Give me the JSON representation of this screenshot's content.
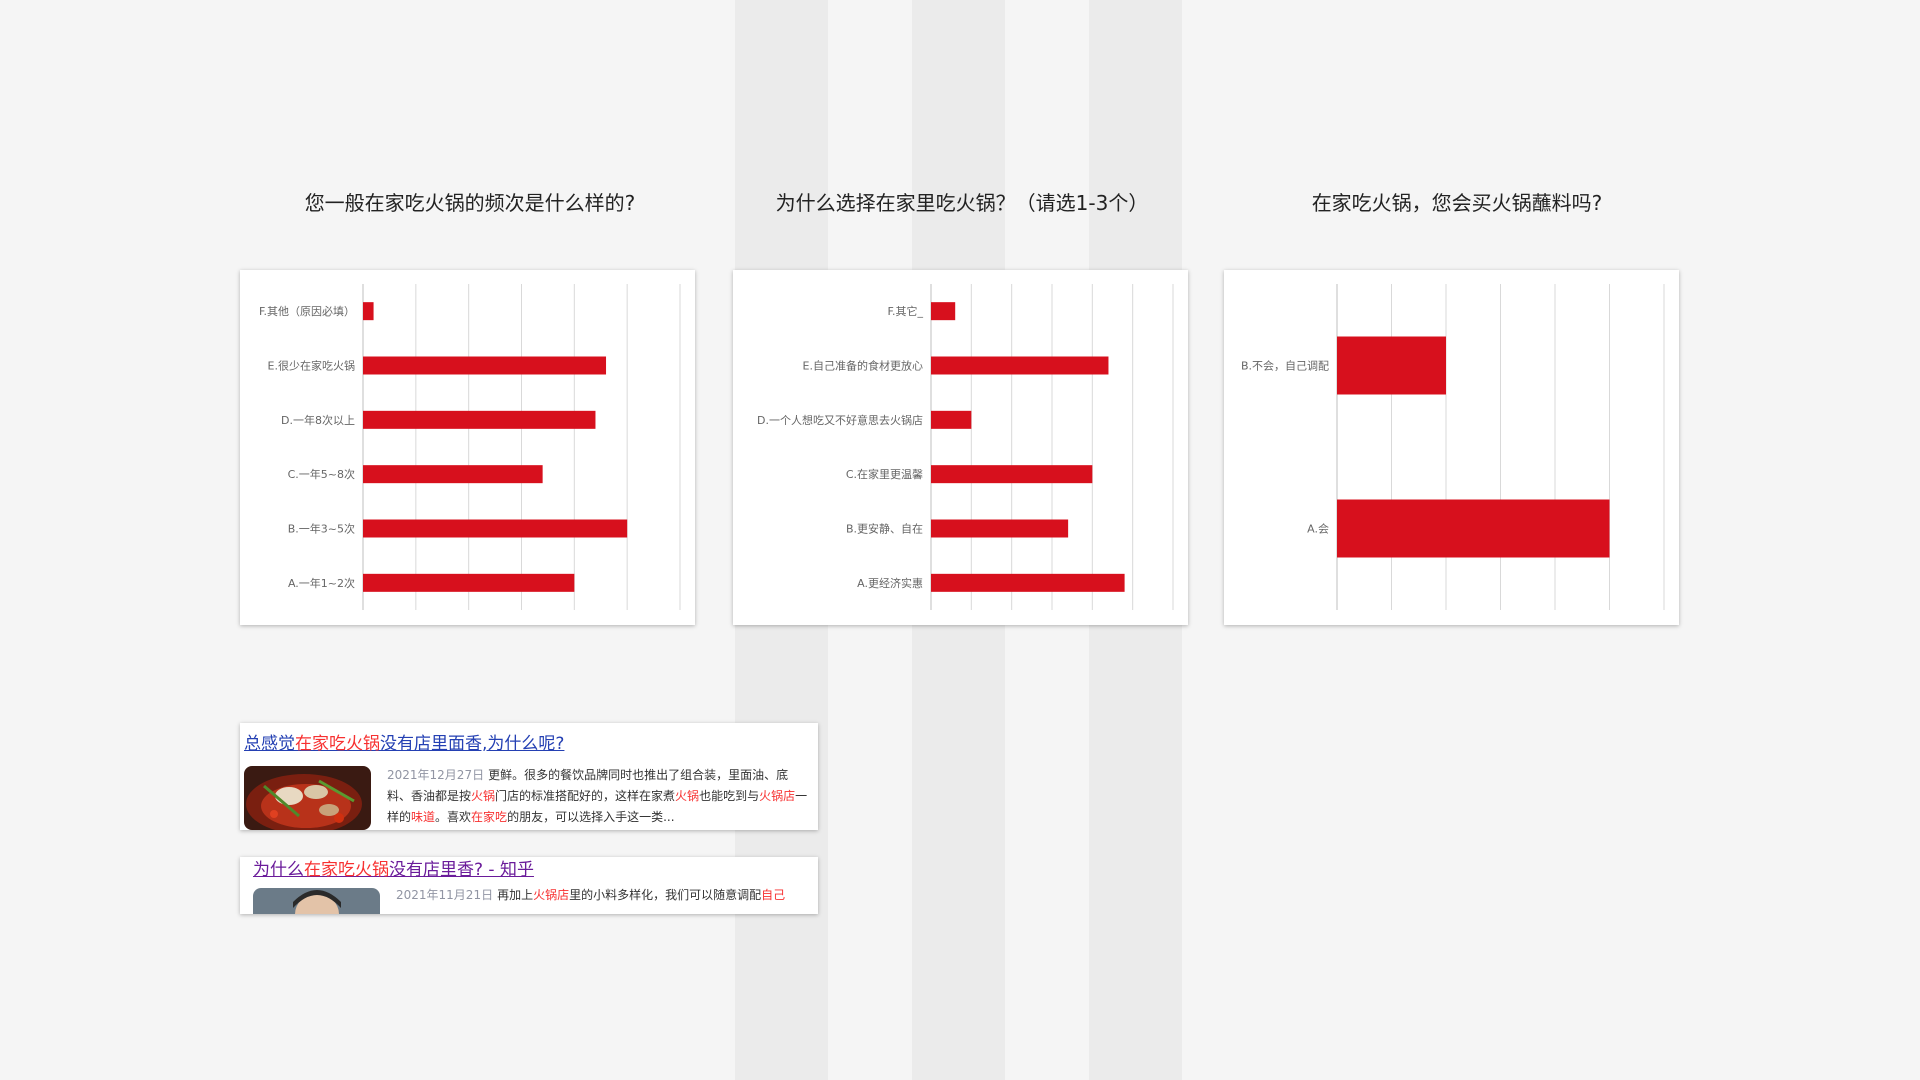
{
  "colors": {
    "bar": "#d7101d",
    "grid": "#d9d9d9",
    "axis_text": "#666666",
    "link": "#2440b3",
    "highlight": "#f73131"
  },
  "chart_data": [
    {
      "type": "bar",
      "orientation": "horizontal",
      "title": "您一般在家吃火锅的频次是什么样的?",
      "categories": [
        "F.其他（原因必填）",
        "E.很少在家吃火锅",
        "D.一年8次以上",
        "C.一年5~8次",
        "B.一年3~5次",
        "A.一年1~2次"
      ],
      "values": [
        2,
        46,
        44,
        34,
        50,
        40
      ],
      "xlim": [
        0,
        60
      ],
      "grid": true,
      "legend": false
    },
    {
      "type": "bar",
      "orientation": "horizontal",
      "title": "为什么选择在家里吃火锅？（请选1-3个）",
      "categories": [
        "F.其它_",
        "E.自己准备的食材更放心",
        "D.一个人想吃又不好意思去火锅店",
        "C.在家里更温馨",
        "B.更安静、自在",
        "A.更经济实惠"
      ],
      "values": [
        6,
        44,
        10,
        40,
        34,
        48
      ],
      "xlim": [
        0,
        60
      ],
      "grid": true,
      "legend": false
    },
    {
      "type": "bar",
      "orientation": "horizontal",
      "title": "在家吃火锅，您会买火锅蘸料吗?",
      "categories": [
        "B.不会，自己调配",
        "A.会"
      ],
      "values": [
        20,
        50
      ],
      "xlim": [
        0,
        60
      ],
      "grid": true,
      "legend": false
    }
  ],
  "results": [
    {
      "title_parts": [
        "总感觉",
        "在家吃火锅",
        "没有店里面香,为什么呢?"
      ],
      "date": "2021年12月27日",
      "snippet_parts": [
        [
          "更鲜。很多的餐饮品牌同时也推出了组合装，里面油、底料、香油都是按",
          false
        ],
        [
          "火锅",
          true
        ],
        [
          "门店的标准搭配好的，这样在家煮",
          false
        ],
        [
          "火锅",
          true
        ],
        [
          "也能吃到与",
          false
        ],
        [
          "火锅店",
          true
        ],
        [
          "一样的",
          false
        ],
        [
          "味道",
          true
        ],
        [
          "。喜欢",
          false
        ],
        [
          "在家吃",
          true
        ],
        [
          "的朋友，可以选择入手这一类...",
          false
        ]
      ]
    },
    {
      "title_parts": [
        "为什么",
        "在家吃火锅",
        "没有店里香? - 知乎"
      ],
      "date": "2021年11月21日",
      "snippet_parts": [
        [
          "再加上",
          false
        ],
        [
          "火锅店",
          true
        ],
        [
          "里的小料多样化，我们可以随意调配",
          false
        ],
        [
          "自己",
          true
        ]
      ]
    }
  ]
}
